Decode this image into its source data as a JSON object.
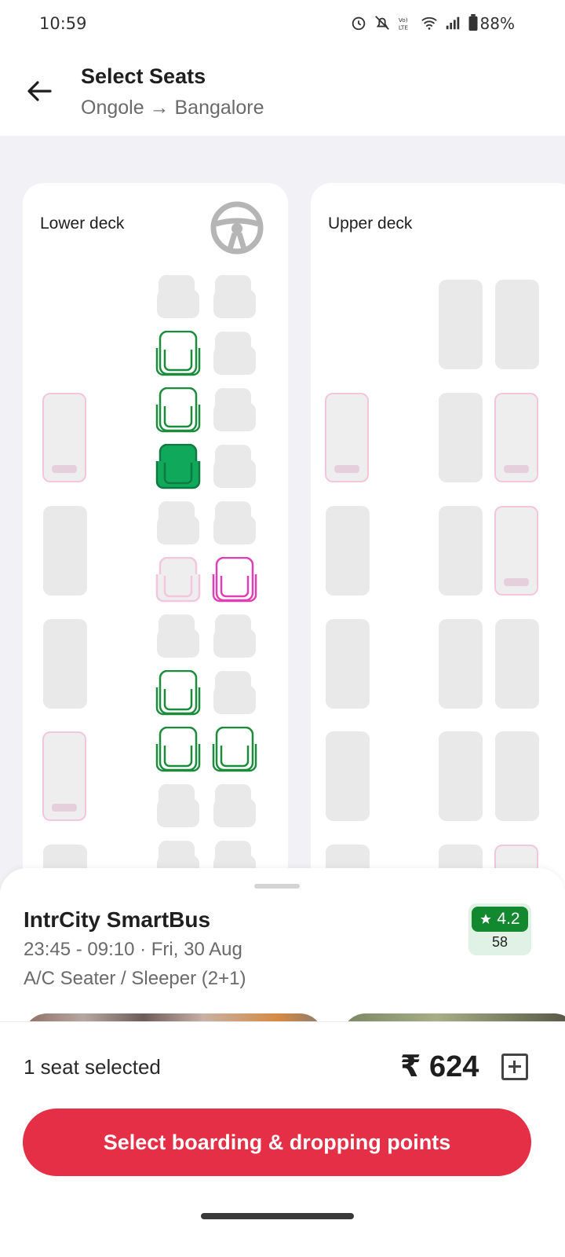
{
  "status_bar": {
    "time": "10:59",
    "battery": "88%",
    "icons": [
      "alarm-icon",
      "mute-icon",
      "volte-icon",
      "wifi-icon",
      "signal-icon",
      "battery-icon"
    ]
  },
  "header": {
    "title": "Select Seats",
    "route": "Ongole → Bangalore"
  },
  "decks": {
    "lower": {
      "label": "Lower deck"
    },
    "upper": {
      "label": "Upper deck"
    }
  },
  "bus": {
    "name": "IntrCity SmartBus",
    "timing": "23:45 - 09:10 · Fri, 30 Aug",
    "type": "A/C Seater / Sleeper (2+1)",
    "rating": "4.2",
    "rating_count": "58"
  },
  "footer": {
    "selection_text": "1 seat selected",
    "price": "₹ 624",
    "cta_label": "Select boarding & dropping points"
  },
  "colors": {
    "available": "#1a8c3b",
    "selected": "#10a95b",
    "ladies": "#e03fb3",
    "booked": "#e9e9ea",
    "cta": "#e42f46"
  }
}
